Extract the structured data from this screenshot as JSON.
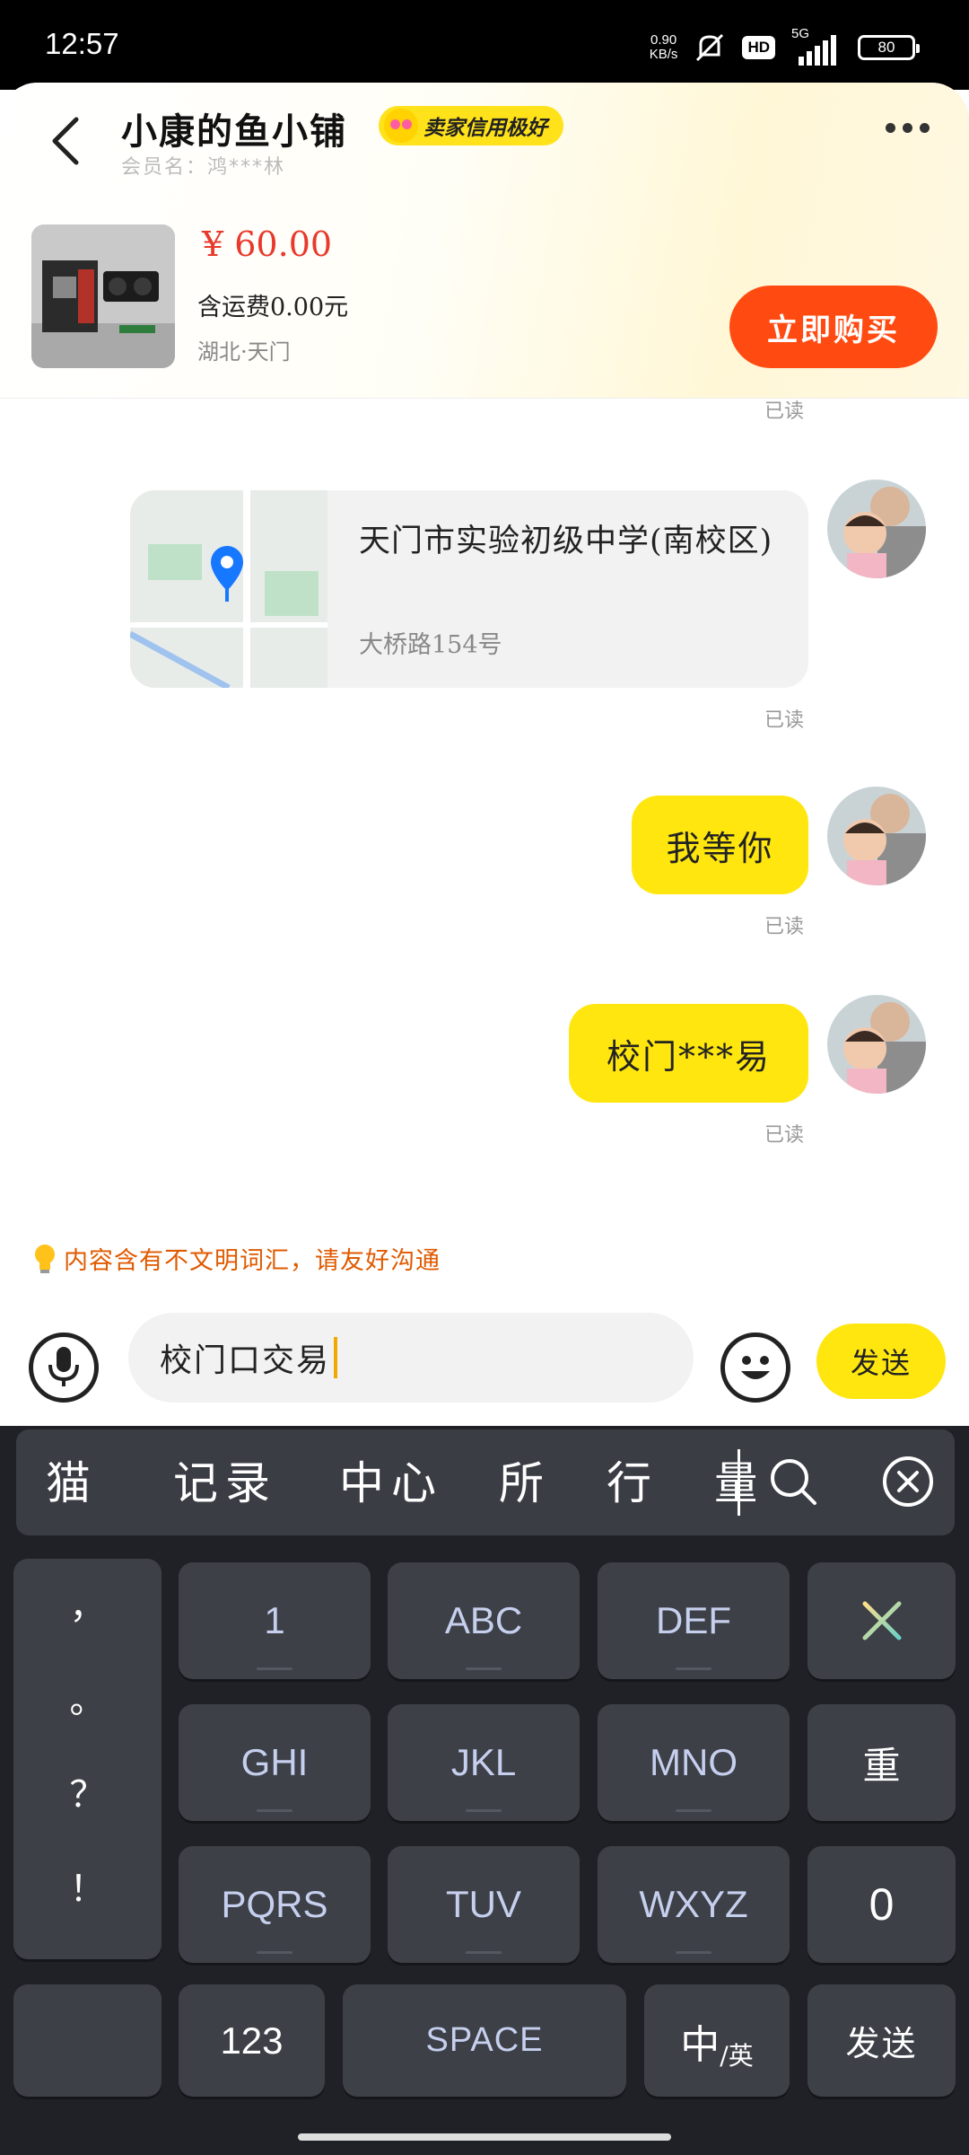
{
  "status_bar": {
    "time": "12:57",
    "net_speed_value": "0.90",
    "net_speed_unit": "KB/s",
    "hd": "HD",
    "network": "5G",
    "battery": "80"
  },
  "header": {
    "shop_name": "小康的鱼小铺",
    "credit_badge": "卖家信用极好",
    "member_name": "会员名：鸿***林"
  },
  "product": {
    "price": "¥ 60.00",
    "shipping": "含运费0.00元",
    "location": "湖北·天门",
    "buy_label": "立即购买"
  },
  "chat": {
    "read_label": "已读",
    "location_card": {
      "title": "天门市实验初级中学(南校区)",
      "address": "大桥路154号"
    },
    "messages": [
      {
        "text": "我等你"
      },
      {
        "text": "校门***易"
      }
    ]
  },
  "warning": {
    "icon": "lightbulb-icon",
    "text": "内容含有不文明词汇，请友好沟通"
  },
  "input": {
    "value": "校门口交易",
    "send_label": "发送"
  },
  "keyboard": {
    "candidates": [
      "猫",
      "记录",
      "中心",
      "所",
      "行",
      "量"
    ],
    "punctuation": [
      "，",
      "。",
      "？",
      "！"
    ],
    "rows": [
      [
        "1",
        "ABC",
        "DEF"
      ],
      [
        "GHI",
        "JKL",
        "MNO"
      ],
      [
        "PQRS",
        "TUV",
        "WXYZ"
      ]
    ],
    "reset_label": "重",
    "zero_label": "0",
    "num_label": "123",
    "space_label": "SPACE",
    "lang_main": "中",
    "lang_sub": "/英",
    "send_label": "发送"
  },
  "colors": {
    "accent_yellow": "#ffe60f",
    "buy_orange": "#ff4b12",
    "price_red": "#e8392b",
    "warning_orange": "#e05a00",
    "keyboard_bg": "#1f2126"
  }
}
